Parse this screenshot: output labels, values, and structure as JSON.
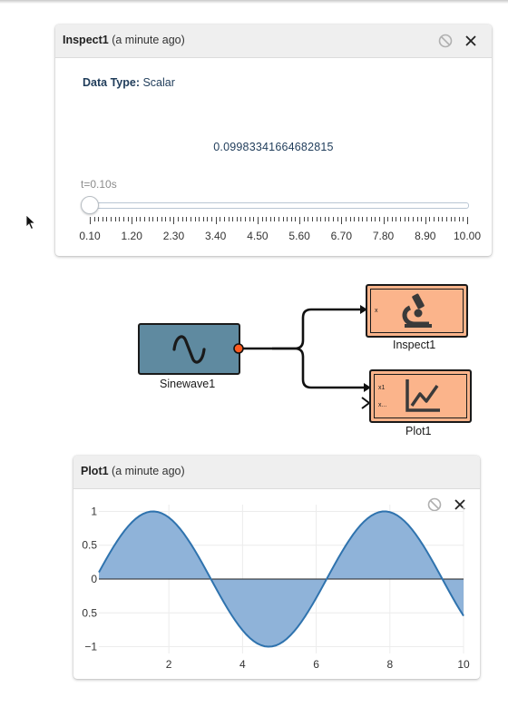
{
  "inspect_panel": {
    "title": "Inspect1",
    "subtitle": "(a minute ago)",
    "data_type_label": "Data Type:",
    "data_type_value": "Scalar",
    "value": "0.09983341664682815",
    "time_label": "t=0.10s",
    "slider": {
      "min": 0.1,
      "max": 10.0,
      "value": 0.1,
      "tick_labels": [
        "0.10",
        "1.20",
        "2.30",
        "3.40",
        "4.50",
        "5.60",
        "6.70",
        "7.80",
        "8.90",
        "10.00"
      ]
    }
  },
  "diagram": {
    "sinewave_block": {
      "label": "Sinewave1",
      "icon": "sine-wave-icon",
      "color": "#5f8aa0"
    },
    "inspect_block": {
      "label": "Inspect1",
      "icon": "microscope-icon",
      "color": "#fbb48b",
      "port_label": "x"
    },
    "plot_block": {
      "label": "Plot1",
      "icon": "line-chart-icon",
      "color": "#fbb48b",
      "port_labels": [
        "x1",
        "x..."
      ]
    }
  },
  "plot_panel": {
    "title": "Plot1",
    "subtitle": "(a minute ago)"
  },
  "chart_data": {
    "type": "area",
    "function": "sin(x)",
    "x_start": 0.1,
    "x_end": 10.0,
    "x_step": 0.1,
    "xlim": [
      0.1,
      10.0
    ],
    "ylim": [
      -1.1,
      1.1
    ],
    "x_ticks": [
      2,
      4,
      6,
      8,
      10
    ],
    "y_ticks": [
      1,
      0.5,
      0,
      -0.5,
      -1
    ],
    "y_tick_labels": [
      "1",
      "0.5",
      "0",
      "0.5",
      "−1"
    ],
    "grid": true,
    "fill_color": "#8fb3d9",
    "line_color": "#2f73ae",
    "zero_line_color": "#222222"
  },
  "colors": {
    "header_bg": "#efefef",
    "text_dark": "#1f3c5a"
  }
}
